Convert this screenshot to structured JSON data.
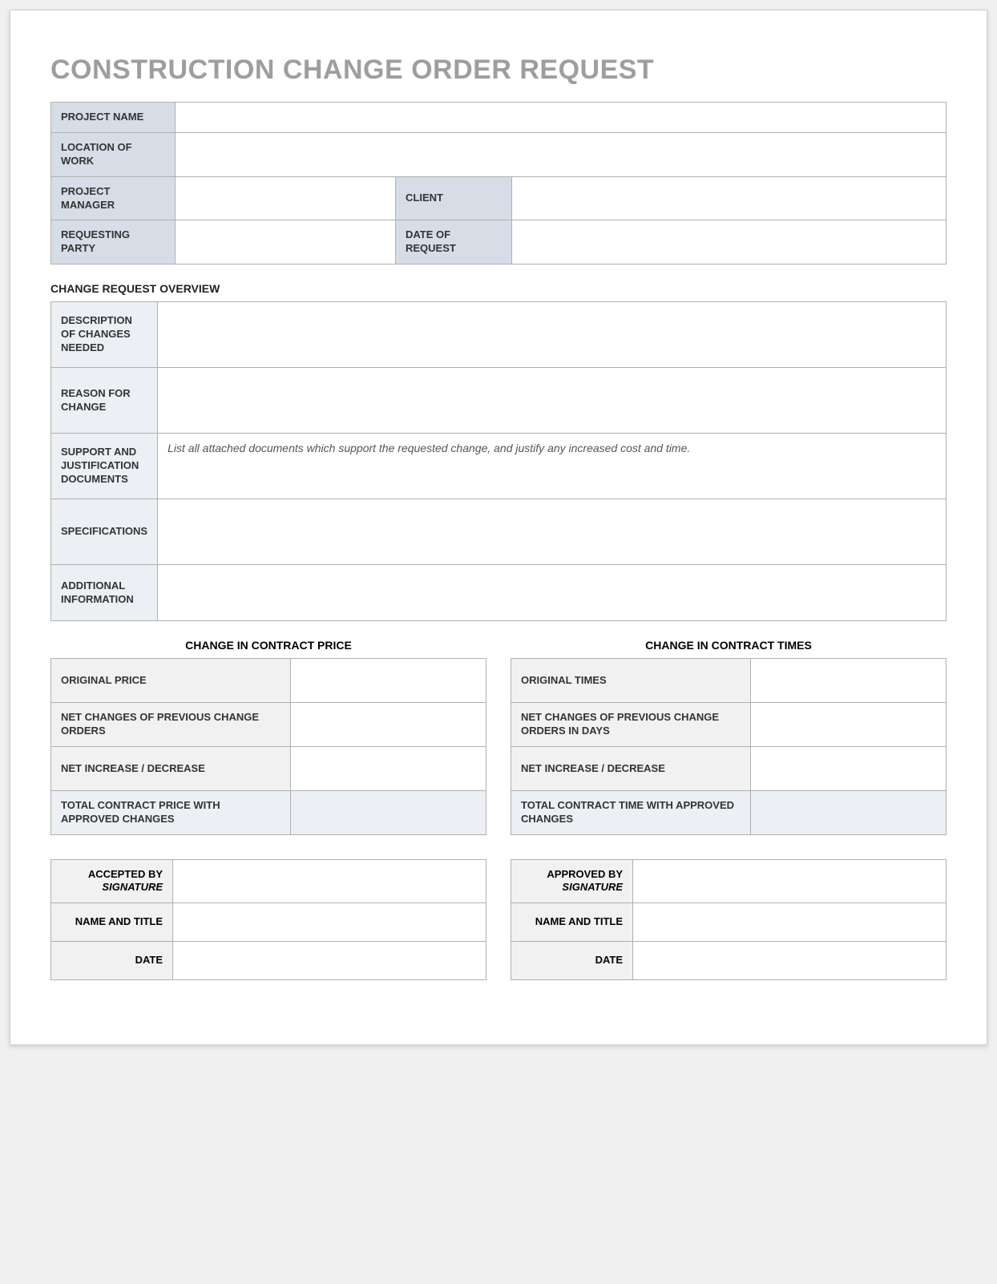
{
  "title": "CONSTRUCTION CHANGE ORDER REQUEST",
  "header": {
    "project_name_label": "PROJECT NAME",
    "project_name": "",
    "location_label": "LOCATION OF WORK",
    "location": "",
    "pm_label": "PROJECT MANAGER",
    "pm": "",
    "client_label": "CLIENT",
    "client": "",
    "requesting_party_label": "REQUESTING PARTY",
    "requesting_party": "",
    "date_request_label": "DATE OF REQUEST",
    "date_request": ""
  },
  "overview": {
    "heading": "CHANGE REQUEST OVERVIEW",
    "rows": {
      "description_label": "DESCRIPTION OF CHANGES NEEDED",
      "description": "",
      "reason_label": "REASON FOR CHANGE",
      "reason": "",
      "support_label": "SUPPORT AND JUSTIFICATION DOCUMENTS",
      "support_note": "List all attached documents which support the requested change, and justify any increased cost and time.",
      "specs_label": "SPECIFICATIONS",
      "specs": "",
      "additional_label": "ADDITIONAL INFORMATION",
      "additional": ""
    }
  },
  "price": {
    "heading": "CHANGE IN CONTRACT PRICE",
    "original_label": "ORIGINAL PRICE",
    "original": "",
    "net_prev_label": "NET CHANGES OF PREVIOUS CHANGE ORDERS",
    "net_prev": "",
    "net_inc_label": "NET INCREASE / DECREASE",
    "net_inc": "",
    "total_label": "TOTAL CONTRACT PRICE WITH APPROVED CHANGES",
    "total": ""
  },
  "times": {
    "heading": "CHANGE IN CONTRACT TIMES",
    "original_label": "ORIGINAL TIMES",
    "original": "",
    "net_prev_label": "NET CHANGES OF PREVIOUS CHANGE ORDERS IN DAYS",
    "net_prev": "",
    "net_inc_label": "NET INCREASE / DECREASE",
    "net_inc": "",
    "total_label": "TOTAL CONTRACT TIME WITH APPROVED CHANGES",
    "total": ""
  },
  "accepted": {
    "sig_label": "ACCEPTED BY",
    "sig_sub": "SIGNATURE",
    "sig": "",
    "name_label": "NAME AND TITLE",
    "name": "",
    "date_label": "DATE",
    "date": ""
  },
  "approved": {
    "sig_label": "APPROVED BY",
    "sig_sub": "SIGNATURE",
    "sig": "",
    "name_label": "NAME AND TITLE",
    "name": "",
    "date_label": "DATE",
    "date": ""
  }
}
